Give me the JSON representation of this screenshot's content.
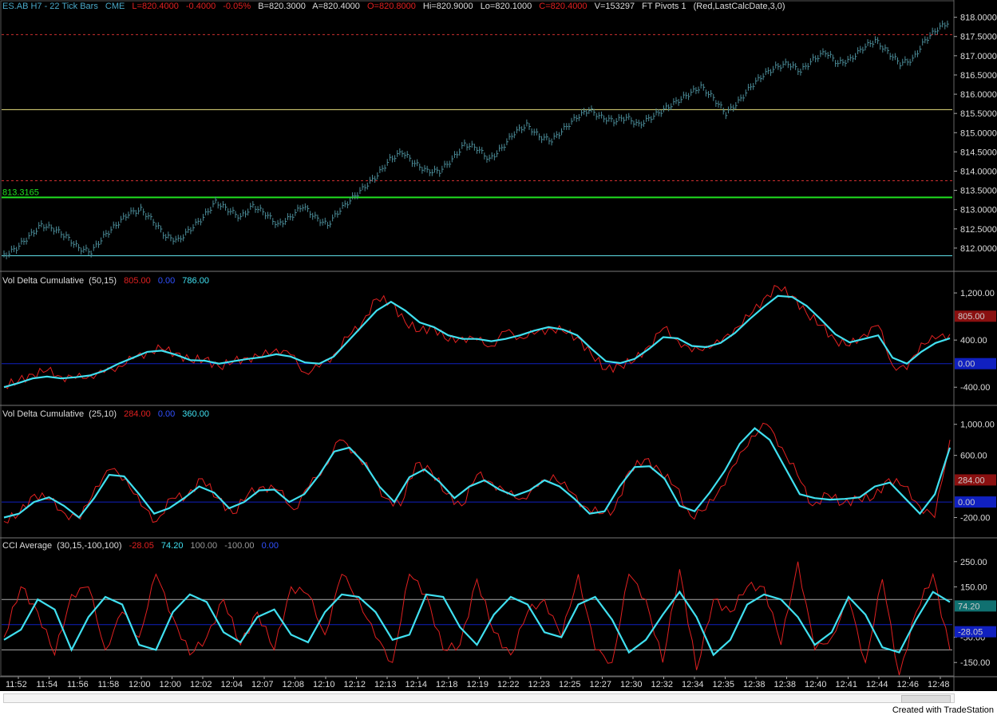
{
  "header": {
    "symbol": "ES.AB H7 - 22 Tick Bars",
    "exchange": "CME",
    "last": "L=820.4000",
    "net": "-0.4000",
    "pct": "-0.05%",
    "bid": "B=820.3000",
    "ask": "A=820.4000",
    "open": "O=820.8000",
    "high": "Hi=820.9000",
    "low": "Lo=820.1000",
    "close": "C=820.4000",
    "volume": "V=153297",
    "study": "FT Pivots 1",
    "study_params": "(Red,LastCalcDate,3,0)"
  },
  "footer": {
    "credit": "Created with TradeStation"
  },
  "colors": {
    "background": "#000000",
    "price_bars": "#4a8a96",
    "red_line": "#e02020",
    "cyan_line": "#40e0f0",
    "zero_line": "#1020c0",
    "pivot_green": "#20e020",
    "pivot_yellow": "#e8e080",
    "pivot_cyan": "#60e0e8",
    "pivot_red_dash": "#d03030",
    "axis_text": "#dddddd"
  },
  "time_labels": [
    "11:52",
    "11:54",
    "11:56",
    "11:58",
    "12:00",
    "12:00",
    "12:02",
    "12:04",
    "12:07",
    "12:08",
    "12:10",
    "12:12",
    "12:13",
    "12:14",
    "12:18",
    "12:19",
    "12:22",
    "12:23",
    "12:25",
    "12:27",
    "12:30",
    "12:32",
    "12:34",
    "12:35",
    "12:38",
    "12:38",
    "12:40",
    "12:41",
    "12:44",
    "12:46",
    "12:48"
  ],
  "chart_data": [
    {
      "type": "bar",
      "name": "price",
      "ylim": [
        811.5,
        818.2
      ],
      "y_ticks": [
        "818.0000",
        "817.5000",
        "817.0000",
        "816.5000",
        "816.0000",
        "815.5000",
        "815.0000",
        "814.5000",
        "814.0000",
        "813.5000",
        "813.0000",
        "812.5000",
        "812.0000"
      ],
      "y_tick_values": [
        818.0,
        817.5,
        817.0,
        816.5,
        816.0,
        815.5,
        815.0,
        814.5,
        814.0,
        813.5,
        813.0,
        812.5,
        812.0
      ],
      "pivots": [
        {
          "value": 813.3165,
          "label": "813.3165",
          "color": "green"
        },
        {
          "value": 815.6,
          "color": "yellow"
        },
        {
          "value": 811.8,
          "color": "cyan"
        },
        {
          "value": 817.55,
          "color": "red-dash"
        },
        {
          "value": 813.75,
          "color": "red-dash"
        }
      ],
      "close": [
        811.8,
        812.0,
        812.3,
        812.6,
        812.5,
        812.3,
        812.0,
        811.9,
        812.3,
        812.6,
        812.9,
        813.0,
        812.7,
        812.3,
        812.2,
        812.5,
        812.8,
        813.2,
        813.0,
        812.8,
        813.1,
        812.9,
        812.6,
        812.8,
        813.1,
        812.8,
        812.6,
        813.0,
        813.3,
        813.6,
        813.9,
        814.3,
        814.5,
        814.2,
        814.0,
        814.0,
        814.3,
        814.7,
        814.6,
        814.3,
        814.6,
        815.0,
        815.2,
        814.9,
        814.8,
        815.1,
        815.4,
        815.6,
        815.4,
        815.3,
        815.4,
        815.2,
        815.4,
        815.6,
        815.8,
        816.0,
        816.2,
        815.9,
        815.5,
        815.8,
        816.2,
        816.5,
        816.7,
        816.8,
        816.6,
        816.9,
        817.1,
        816.8,
        816.9,
        817.2,
        817.4,
        817.1,
        816.8,
        816.9,
        817.4,
        817.7,
        817.9
      ]
    },
    {
      "type": "line",
      "title": "Vol Delta Cumulative",
      "params": "(50,15)",
      "legend_values": [
        "805.00",
        "0.00",
        "786.00"
      ],
      "ylim": [
        -600,
        1350
      ],
      "y_ticks": [
        "1,200.00",
        "400.00",
        "-400.00"
      ],
      "y_tick_values": [
        1200,
        400,
        -400
      ],
      "markers": [
        {
          "label": "805.00",
          "color": "#8a1010"
        },
        {
          "label": "0.00",
          "color": "#1020c0"
        }
      ],
      "series": [
        {
          "color": "red",
          "values": [
            -380,
            -300,
            -180,
            -120,
            -220,
            -250,
            -200,
            -150,
            -40,
            80,
            200,
            250,
            180,
            50,
            80,
            -50,
            30,
            100,
            120,
            250,
            150,
            -150,
            -60,
            150,
            450,
            700,
            1100,
            1050,
            700,
            550,
            620,
            380,
            450,
            400,
            300,
            550,
            450,
            500,
            600,
            550,
            450,
            150,
            -100,
            -30,
            50,
            300,
            600,
            400,
            200,
            300,
            350,
            600,
            800,
            1100,
            1300,
            1150,
            850,
            650,
            400,
            300,
            500,
            650,
            -30,
            -100,
            350,
            420,
            500
          ]
        },
        {
          "color": "cyan",
          "values": [
            -400,
            -330,
            -250,
            -220,
            -250,
            -230,
            -200,
            -120,
            0,
            100,
            200,
            220,
            150,
            60,
            50,
            0,
            40,
            80,
            110,
            160,
            120,
            20,
            0,
            120,
            380,
            640,
            900,
            1050,
            900,
            700,
            620,
            480,
            420,
            420,
            380,
            420,
            480,
            560,
            620,
            580,
            480,
            250,
            40,
            10,
            80,
            250,
            450,
            430,
            300,
            280,
            350,
            520,
            750,
            960,
            1150,
            1130,
            980,
            750,
            500,
            360,
            420,
            480,
            100,
            0,
            200,
            350,
            430
          ]
        }
      ]
    },
    {
      "type": "line",
      "title": "Vol Delta Cumulative",
      "params": "(25,10)",
      "legend_values": [
        "284.00",
        "0.00",
        "360.00"
      ],
      "ylim": [
        -400,
        1100
      ],
      "y_ticks": [
        "1,000.00",
        "600.00",
        "-200.00"
      ],
      "y_tick_values": [
        1000,
        600,
        -200
      ],
      "markers": [
        {
          "label": "284.00",
          "color": "#8a1010"
        },
        {
          "label": "0.00",
          "color": "#1020c0"
        }
      ],
      "series": [
        {
          "color": "red",
          "values": [
            -250,
            -150,
            100,
            30,
            -150,
            -220,
            200,
            420,
            300,
            -50,
            -250,
            50,
            80,
            300,
            50,
            -150,
            100,
            200,
            150,
            -100,
            200,
            450,
            800,
            650,
            380,
            50,
            -50,
            500,
            400,
            100,
            -50,
            350,
            250,
            100,
            50,
            200,
            350,
            150,
            -50,
            -150,
            -100,
            400,
            550,
            400,
            200,
            -180,
            -100,
            200,
            500,
            850,
            1000,
            700,
            350,
            -50,
            100,
            -20,
            50,
            50,
            300,
            200,
            -50,
            -200,
            800
          ]
        },
        {
          "color": "cyan",
          "values": [
            -200,
            -150,
            0,
            60,
            -50,
            -200,
            50,
            350,
            330,
            100,
            -150,
            -80,
            50,
            200,
            120,
            -80,
            0,
            150,
            160,
            0,
            100,
            350,
            650,
            700,
            500,
            200,
            0,
            320,
            420,
            260,
            50,
            200,
            280,
            160,
            80,
            150,
            280,
            200,
            40,
            -150,
            -120,
            200,
            450,
            460,
            300,
            -50,
            -120,
            120,
            400,
            750,
            950,
            800,
            450,
            100,
            50,
            30,
            40,
            60,
            200,
            250,
            50,
            -150,
            100,
            700
          ]
        }
      ]
    },
    {
      "type": "line",
      "title": "CCI Average",
      "params": "(30,15,-100,100)",
      "legend_values": [
        "-28.05",
        "74.20",
        "100.00",
        "-100.00",
        "0.00"
      ],
      "ylim": [
        -200,
        300
      ],
      "y_ticks": [
        "250.00",
        "150.00",
        "-50.00",
        "-150.00"
      ],
      "y_tick_values": [
        250,
        150,
        -50,
        -150
      ],
      "reference_lines": [
        100,
        0,
        -100
      ],
      "markers": [
        {
          "label": "74.20",
          "color": "#107070"
        },
        {
          "label": "-28.05",
          "color": "#1020c0"
        }
      ],
      "series": [
        {
          "color": "red",
          "values": [
            -50,
            150,
            50,
            -120,
            120,
            150,
            -100,
            50,
            -50,
            200,
            30,
            -120,
            -50,
            100,
            -80,
            50,
            -100,
            150,
            120,
            -40,
            200,
            100,
            -50,
            -150,
            200,
            120,
            -100,
            -80,
            180,
            -30,
            -120,
            50,
            100,
            -50,
            200,
            -100,
            -150,
            200,
            100,
            -150,
            220,
            -180,
            100,
            50,
            150,
            150,
            -80,
            250,
            -100,
            -50,
            100,
            -150,
            180,
            -200,
            50,
            200,
            -100
          ]
        },
        {
          "color": "cyan",
          "values": [
            -60,
            -20,
            100,
            60,
            -100,
            30,
            110,
            80,
            -80,
            -100,
            50,
            120,
            90,
            -30,
            -70,
            30,
            60,
            -40,
            -70,
            50,
            120,
            110,
            50,
            -60,
            -40,
            120,
            110,
            -10,
            -80,
            40,
            110,
            80,
            -30,
            -50,
            80,
            110,
            20,
            -110,
            -60,
            40,
            130,
            30,
            -120,
            -60,
            80,
            120,
            100,
            30,
            -80,
            -30,
            110,
            40,
            -90,
            -110,
            20,
            130,
            90
          ]
        }
      ]
    }
  ]
}
